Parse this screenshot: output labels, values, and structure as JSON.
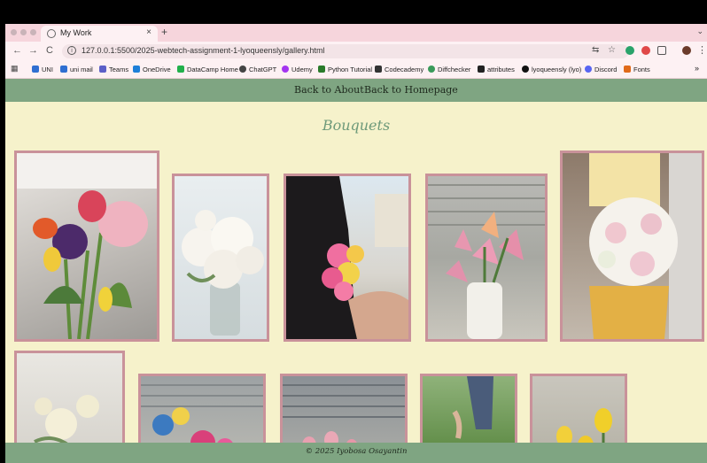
{
  "browser": {
    "tab_title": "My Work",
    "tab_close": "×",
    "new_tab": "+",
    "tab_menu": "⌄",
    "back": "←",
    "forward": "→",
    "reload": "C",
    "url": "127.0.0.1:5500/2025-webtech-assignment-1-lyoqueensly/gallery.html",
    "bookmarks": [
      {
        "label": "UNI",
        "color": "#2f6fd1"
      },
      {
        "label": "uni mail",
        "color": "#2f6fd1"
      },
      {
        "label": "Teams",
        "color": "#5b5fc7"
      },
      {
        "label": "OneDrive",
        "color": "#1e7fd8"
      },
      {
        "label": "DataCamp Home",
        "color": "#22b04b"
      },
      {
        "label": "ChatGPT",
        "color": "#444444"
      },
      {
        "label": "Udemy",
        "color": "#a435f0"
      },
      {
        "label": "Python Tutorial",
        "color": "#2a7a2a"
      },
      {
        "label": "Codecademy",
        "color": "#333333"
      },
      {
        "label": "Diffchecker",
        "color": "#3a9a5a"
      },
      {
        "label": "attributes",
        "color": "#222222"
      },
      {
        "label": "lyoqueensly (lyo)",
        "color": "#111111"
      },
      {
        "label": "Discord",
        "color": "#5865f2"
      },
      {
        "label": "Fonts",
        "color": "#e06a1a"
      }
    ],
    "bookmarks_more": "»"
  },
  "nav": {
    "links": [
      "Back to About",
      "Back to Homepage"
    ]
  },
  "gallery": {
    "heading": "Bouquets"
  },
  "footer": {
    "text": "© 2025 Iyobosa Osayantin"
  },
  "colors": {
    "page_bg": "#f6f2cb",
    "nav_bg": "#7fa582",
    "frame": "#c9929a",
    "heading": "#6e9a7a"
  }
}
